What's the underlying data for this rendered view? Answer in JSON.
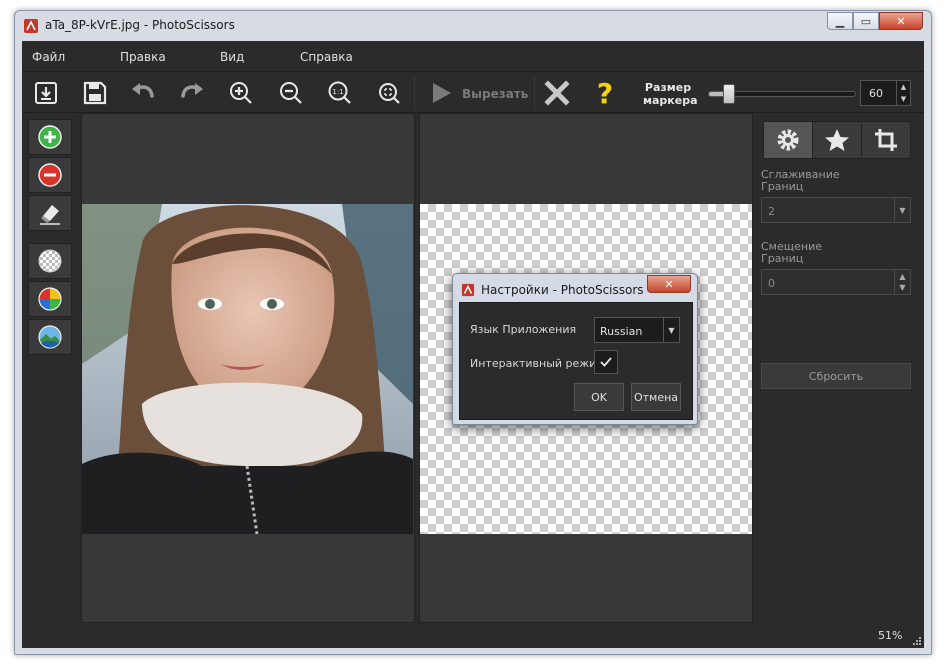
{
  "window": {
    "title": "aTa_8P-kVrE.jpg - PhotoScissors"
  },
  "menu": [
    "Файл",
    "Правка",
    "Вид",
    "Справка"
  ],
  "toolbar": {
    "cut_label": "Вырезать",
    "marker_label": "Размер маркера",
    "marker_size": "60",
    "marker_fraction": 0.1,
    "icons": [
      "open-icon",
      "save-icon",
      "undo-icon",
      "redo-icon",
      "zoom-in-icon",
      "zoom-out-icon",
      "zoom-actual-icon",
      "zoom-fit-icon",
      "play-icon",
      "delete-icon",
      "help-icon"
    ]
  },
  "left_tools": [
    "add-marker-icon",
    "remove-marker-icon",
    "eraser-icon",
    "transparent-bg-icon",
    "color-bg-icon",
    "image-bg-icon"
  ],
  "right_panel": {
    "tabs": [
      "gear-icon",
      "star-icon",
      "crop-icon"
    ],
    "smoothing_label": "Сглаживание Границ",
    "smoothing_value": "2",
    "offset_label": "Смещение Границ",
    "offset_value": "0",
    "reset_label": "Сбросить"
  },
  "status": {
    "zoom": "51%"
  },
  "dialog": {
    "title": "Настройки - PhotoScissors",
    "language_label": "Язык Приложения",
    "language_value": "Russian",
    "interactive_label": "Интерактивный режим",
    "interactive_checked": true,
    "ok_label": "OK",
    "cancel_label": "Отмена"
  },
  "colors": {
    "background": "#2b2b2b",
    "panel": "#383838",
    "add_green": "#3cb44a",
    "remove_red": "#d9342b",
    "help_yellow": "#f5d40f"
  }
}
